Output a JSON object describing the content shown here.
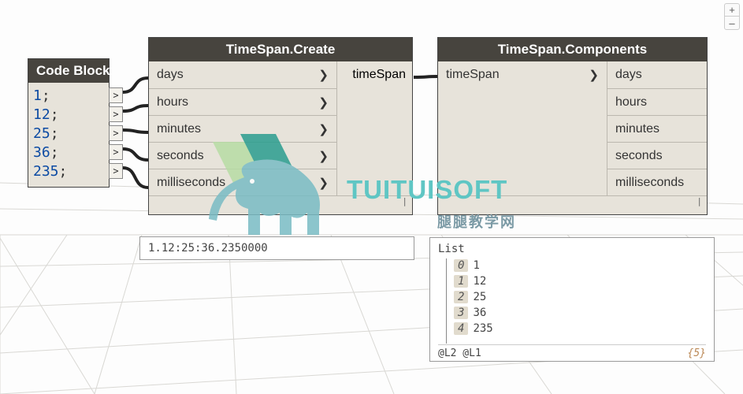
{
  "codeBlock": {
    "title": "Code Block",
    "lines": [
      "1",
      "12",
      "25",
      "36",
      "235"
    ],
    "semicolon": ";",
    "port_glyph": ">"
  },
  "tsCreate": {
    "title": "TimeSpan.Create",
    "inputs": [
      "days",
      "hours",
      "minutes",
      "seconds",
      "milliseconds"
    ],
    "output": "timeSpan",
    "chev": "❯",
    "footer": "|",
    "preview": "1.12:25:36.2350000"
  },
  "tsComp": {
    "title": "TimeSpan.Components",
    "input": "timeSpan",
    "outputs": [
      "days",
      "hours",
      "minutes",
      "seconds",
      "milliseconds"
    ],
    "chev": "❯",
    "footer": "|",
    "preview": {
      "head": "List",
      "rows": [
        {
          "idx": "0",
          "val": "1"
        },
        {
          "idx": "1",
          "val": "12"
        },
        {
          "idx": "2",
          "val": "25"
        },
        {
          "idx": "3",
          "val": "36"
        },
        {
          "idx": "4",
          "val": "235"
        }
      ],
      "lacing": "@L2 @L1",
      "count": "{5}"
    }
  },
  "zoom": {
    "plus": "+",
    "minus": "–"
  },
  "watermark": {
    "brand": "TUITUISOFT",
    "sub": "腿腿教学网"
  }
}
